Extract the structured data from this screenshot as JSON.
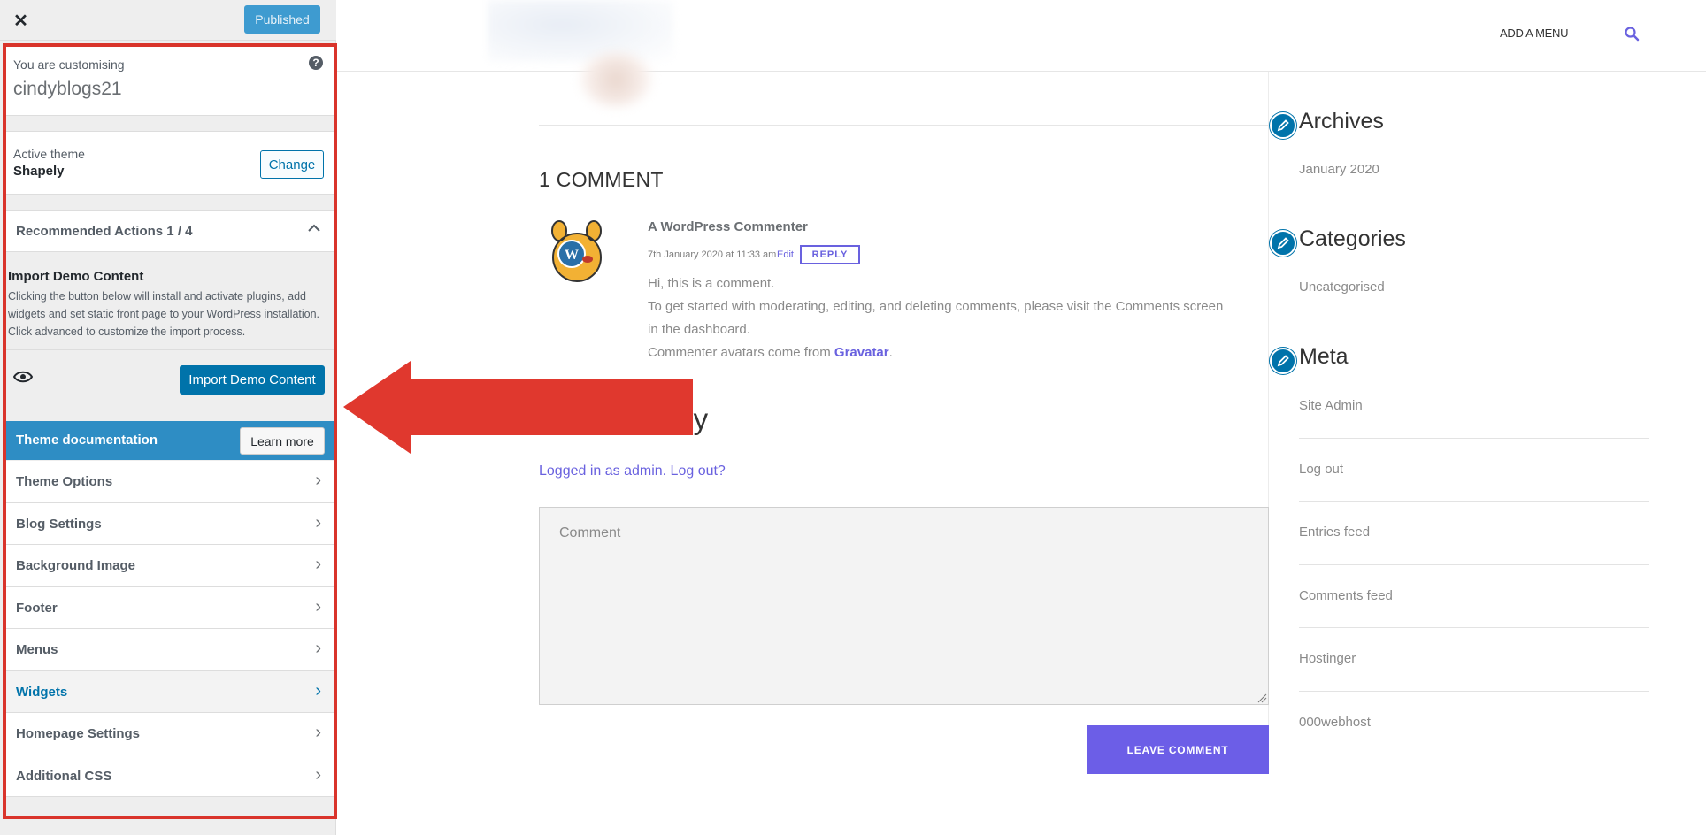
{
  "customizer": {
    "close_icon": "close-icon",
    "publish_label": "Published",
    "customising_label": "You are customising",
    "site_name": "cindyblogs21",
    "help_icon": "help-icon",
    "active_theme_label": "Active theme",
    "theme_name": "Shapely",
    "change_label": "Change",
    "recommended_label": "Recommended Actions 1 / 4",
    "import": {
      "title": "Import Demo Content",
      "description": "Clicking the button below will install and activate plugins, add widgets and set static front page to your WordPress installation. Click advanced to customize the import process.",
      "button_label": "Import Demo Content",
      "eye_icon": "eye-icon"
    },
    "docs": {
      "label": "Theme documentation",
      "button_label": "Learn more"
    },
    "sections": [
      {
        "label": "Theme Options"
      },
      {
        "label": "Blog Settings"
      },
      {
        "label": "Background Image"
      },
      {
        "label": "Footer"
      },
      {
        "label": "Menus"
      },
      {
        "label": "Widgets",
        "active": true
      },
      {
        "label": "Homepage Settings"
      },
      {
        "label": "Additional CSS"
      }
    ],
    "chevron_right": "›",
    "chevron_up": "︿"
  },
  "preview": {
    "add_menu_label": "ADD A MENU",
    "search_icon": "search-icon",
    "comments_title": "1 COMMENT",
    "comment": {
      "author": "A WordPress Commenter",
      "date": "7th January 2020 at 11:33 am",
      "edit_label": "Edit",
      "reply_label": "REPLY",
      "line1": "Hi, this is a comment.",
      "line2": "To get started with moderating, editing, and deleting comments, please visit the Comments screen",
      "line3": "in the dashboard.",
      "line4_pre": "Commenter avatars come from ",
      "line4_link": "Gravatar",
      "line4_post": "."
    },
    "reply_title_visible": "ply",
    "logged_in_text": "Logged in as admin. Log out?",
    "comment_placeholder": "Comment",
    "leave_comment_label": "LEAVE COMMENT",
    "widgets": {
      "archives_title": "Archives",
      "archives_items": [
        "January 2020"
      ],
      "categories_title": "Categories",
      "categories_items": [
        "Uncategorised"
      ],
      "meta_title": "Meta",
      "meta_items": [
        "Site Admin",
        "Log out",
        "Entries feed",
        "Comments feed",
        "Hostinger",
        "000webhost"
      ]
    }
  },
  "colors": {
    "annotation_red": "#d9342b",
    "wp_blue": "#0073aa",
    "accent_purple": "#6c5ee7"
  }
}
